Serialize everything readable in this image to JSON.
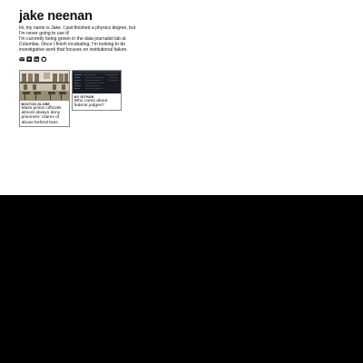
{
  "header": {
    "title": "jake neenan"
  },
  "bio": {
    "line1": "Hi, my name is Jake. I just finished a physics degree, but I'm never going to use it!",
    "line2": "I'm currently being grown in the data journalist lab at Columbia. Once I finish incubating, I'm looking to do investigative work that focuses on institutional failure."
  },
  "socials": [
    {
      "icon": "email-icon"
    },
    {
      "icon": "twitter-icon"
    },
    {
      "icon": "linkedin-icon"
    },
    {
      "icon": "github-icon"
    }
  ],
  "cards": [
    {
      "source": "BOSTON GLOBE",
      "title": "Mass prison officials almost always deny prisoners' claims of abuse behind bars"
    },
    {
      "source": "MY GITHUB",
      "title": "Who cares about federal judges?"
    }
  ],
  "colors": {
    "page_background": "#ffffff",
    "outside_background": "#000000",
    "text": "#111111",
    "card_border": "#888888",
    "github_thumb_background": "#181c22"
  }
}
